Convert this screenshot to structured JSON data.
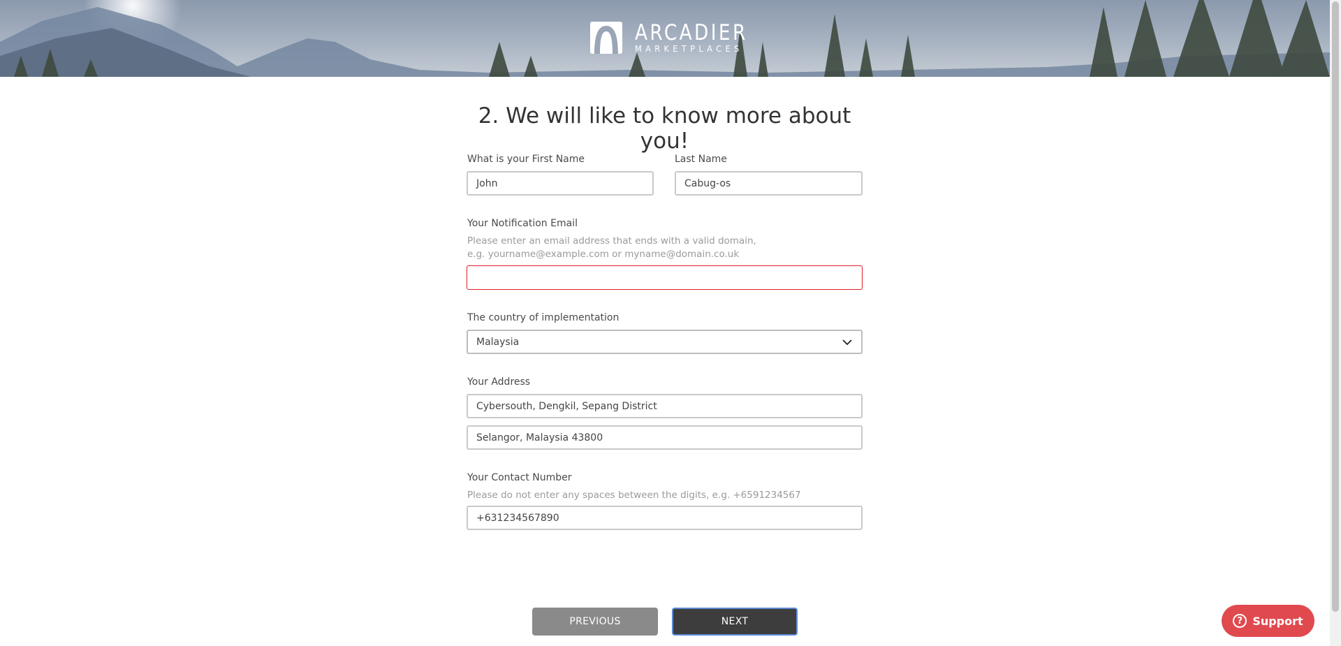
{
  "header": {
    "logo_title": "ARCADIER",
    "logo_subtitle": "MARKETPLACES"
  },
  "form": {
    "heading": "2. We will like to know more about you!",
    "first_name": {
      "label": "What is your First Name",
      "value": "John"
    },
    "last_name": {
      "label": "Last Name",
      "value": "Cabug-os"
    },
    "email": {
      "label": "Your Notification Email",
      "hint_line1": "Please enter an email address that ends with a valid domain,",
      "hint_line2": "e.g. yourname@example.com or myname@domain.co.uk",
      "value": ""
    },
    "country": {
      "label": "The country of implementation",
      "value": "Malaysia"
    },
    "address": {
      "label": "Your Address",
      "line1": "Cybersouth, Dengkil, Sepang District",
      "line2": "Selangor, Malaysia 43800"
    },
    "contact": {
      "label": "Your Contact Number",
      "hint": "Please do not enter any spaces between the digits, e.g. +6591234567",
      "value": "+631234567890"
    }
  },
  "buttons": {
    "previous": "PREVIOUS",
    "next": "NEXT"
  },
  "support": {
    "icon": "?",
    "label": "Support"
  },
  "colors": {
    "error_border": "#e11c26",
    "support_bg": "#e04a4f",
    "next_bg": "#3d3d3d",
    "prev_bg": "#8a8a8a"
  }
}
